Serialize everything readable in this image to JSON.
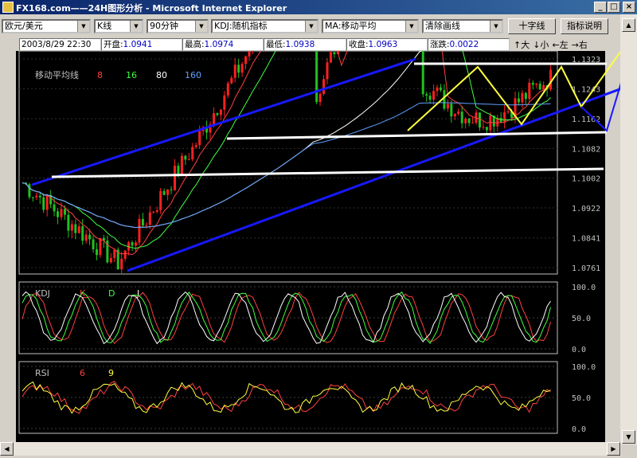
{
  "window": {
    "title": "FX168.com——24H图形分析 - Microsoft Internet Explorer",
    "buttons": [
      "_",
      "□",
      "×"
    ]
  },
  "toolbar": {
    "pair": "欧元/美元",
    "chart_type": "K线",
    "period": "90分钟",
    "indicator": "KDJ:随机指标",
    "overlay": "MA:移动平均",
    "clear": "清除画线",
    "crosshair_label": "十字线",
    "help_label": "指标说明"
  },
  "quote": {
    "datetime": "2003/8/29 22:30",
    "open_label": "开盘:",
    "open": "1.0941",
    "high_label": "最高:",
    "high": "1.0974",
    "low_label": "最低:",
    "low": "1.0938",
    "close_label": "收盘:",
    "close": "1.0963",
    "change_label": "涨跌:",
    "change": "0.0022"
  },
  "nav": {
    "bigger": "↑大",
    "smaller": "↓小",
    "left": "←左",
    "right": "→右"
  },
  "colors": {
    "chart_bg": "#000000",
    "up": "#ff2020",
    "down": "#20c020",
    "trend": "#1818ff",
    "support": "#ffffff",
    "pattern": "#ffff40",
    "grid": "#808080"
  },
  "chart_data": [
    {
      "type": "candlestick",
      "legend_title": "移动平均线",
      "ma_periods": [
        "8",
        "16",
        "80",
        "160"
      ],
      "ma_colors": [
        "#ff4040",
        "#40ff40",
        "#ffffff",
        "#60a0ff"
      ],
      "y_ticks": [
        "1.1323",
        "1.1243",
        "1.1162",
        "1.1082",
        "1.1002",
        "1.0922",
        "1.0841",
        "1.0761"
      ],
      "ylim": [
        1.0761,
        1.1323
      ],
      "bars": 150,
      "annotations": [
        "up-channel trendlines",
        "horizontal support lines",
        "zigzag wave"
      ]
    },
    {
      "type": "line",
      "name": "KDJ",
      "series_labels": [
        "K",
        "D",
        "J"
      ],
      "series_colors": [
        "#ff4040",
        "#40ff40",
        "#ffffff"
      ],
      "y_ticks": [
        "100.0",
        "50.0",
        "0.0"
      ],
      "ylim": [
        0,
        100
      ]
    },
    {
      "type": "line",
      "name": "RSI",
      "series_labels": [
        "6",
        "9"
      ],
      "series_colors": [
        "#ff4040",
        "#ffff40"
      ],
      "y_ticks": [
        "100.0",
        "50.0",
        "0.0"
      ],
      "ylim": [
        0,
        100
      ]
    }
  ]
}
